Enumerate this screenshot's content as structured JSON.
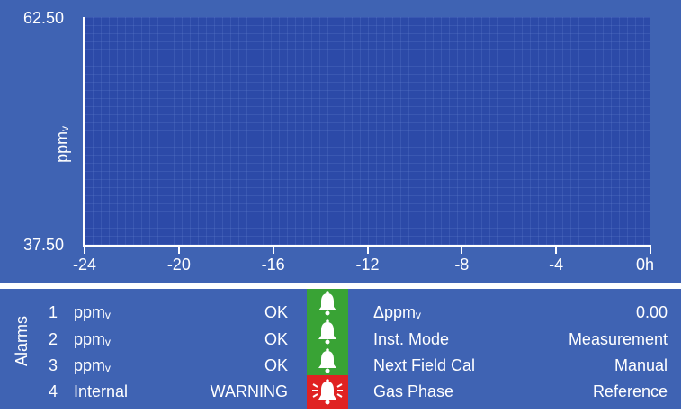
{
  "chart": {
    "y_max_label": "62.50",
    "y_min_label": "37.50",
    "y_axis_label": "ppmᵥ",
    "x_ticks": [
      "-24",
      "-20",
      "-16",
      "-12",
      "-8",
      "-4",
      "0h"
    ]
  },
  "chart_data": {
    "type": "line",
    "x": [
      -24,
      -20,
      -16,
      -12,
      -8,
      -4,
      0
    ],
    "series": [],
    "xlabel": "",
    "ylabel": "ppmᵥ",
    "ylim": [
      37.5,
      62.5
    ],
    "xlim": [
      -24,
      0
    ],
    "grid": true
  },
  "alarms": {
    "title": "Alarms",
    "rows": [
      {
        "num": "1",
        "label": "ppmᵥ",
        "status": "OK",
        "state": "ok"
      },
      {
        "num": "2",
        "label": "ppmᵥ",
        "status": "OK",
        "state": "ok"
      },
      {
        "num": "3",
        "label": "ppmᵥ",
        "status": "OK",
        "state": "ok"
      },
      {
        "num": "4",
        "label": "Internal",
        "status": "WARNING",
        "state": "warning"
      }
    ],
    "icon": "bell-icon",
    "colors": {
      "ok": "#39a335",
      "warning": "#e02222",
      "panel": "#3f63b3"
    }
  },
  "info": [
    {
      "label": "Δppmᵥ",
      "value": "0.00"
    },
    {
      "label": "Inst. Mode",
      "value": "Measurement"
    },
    {
      "label": "Next Field Cal",
      "value": "Manual"
    },
    {
      "label": "Gas Phase",
      "value": "Reference"
    }
  ]
}
